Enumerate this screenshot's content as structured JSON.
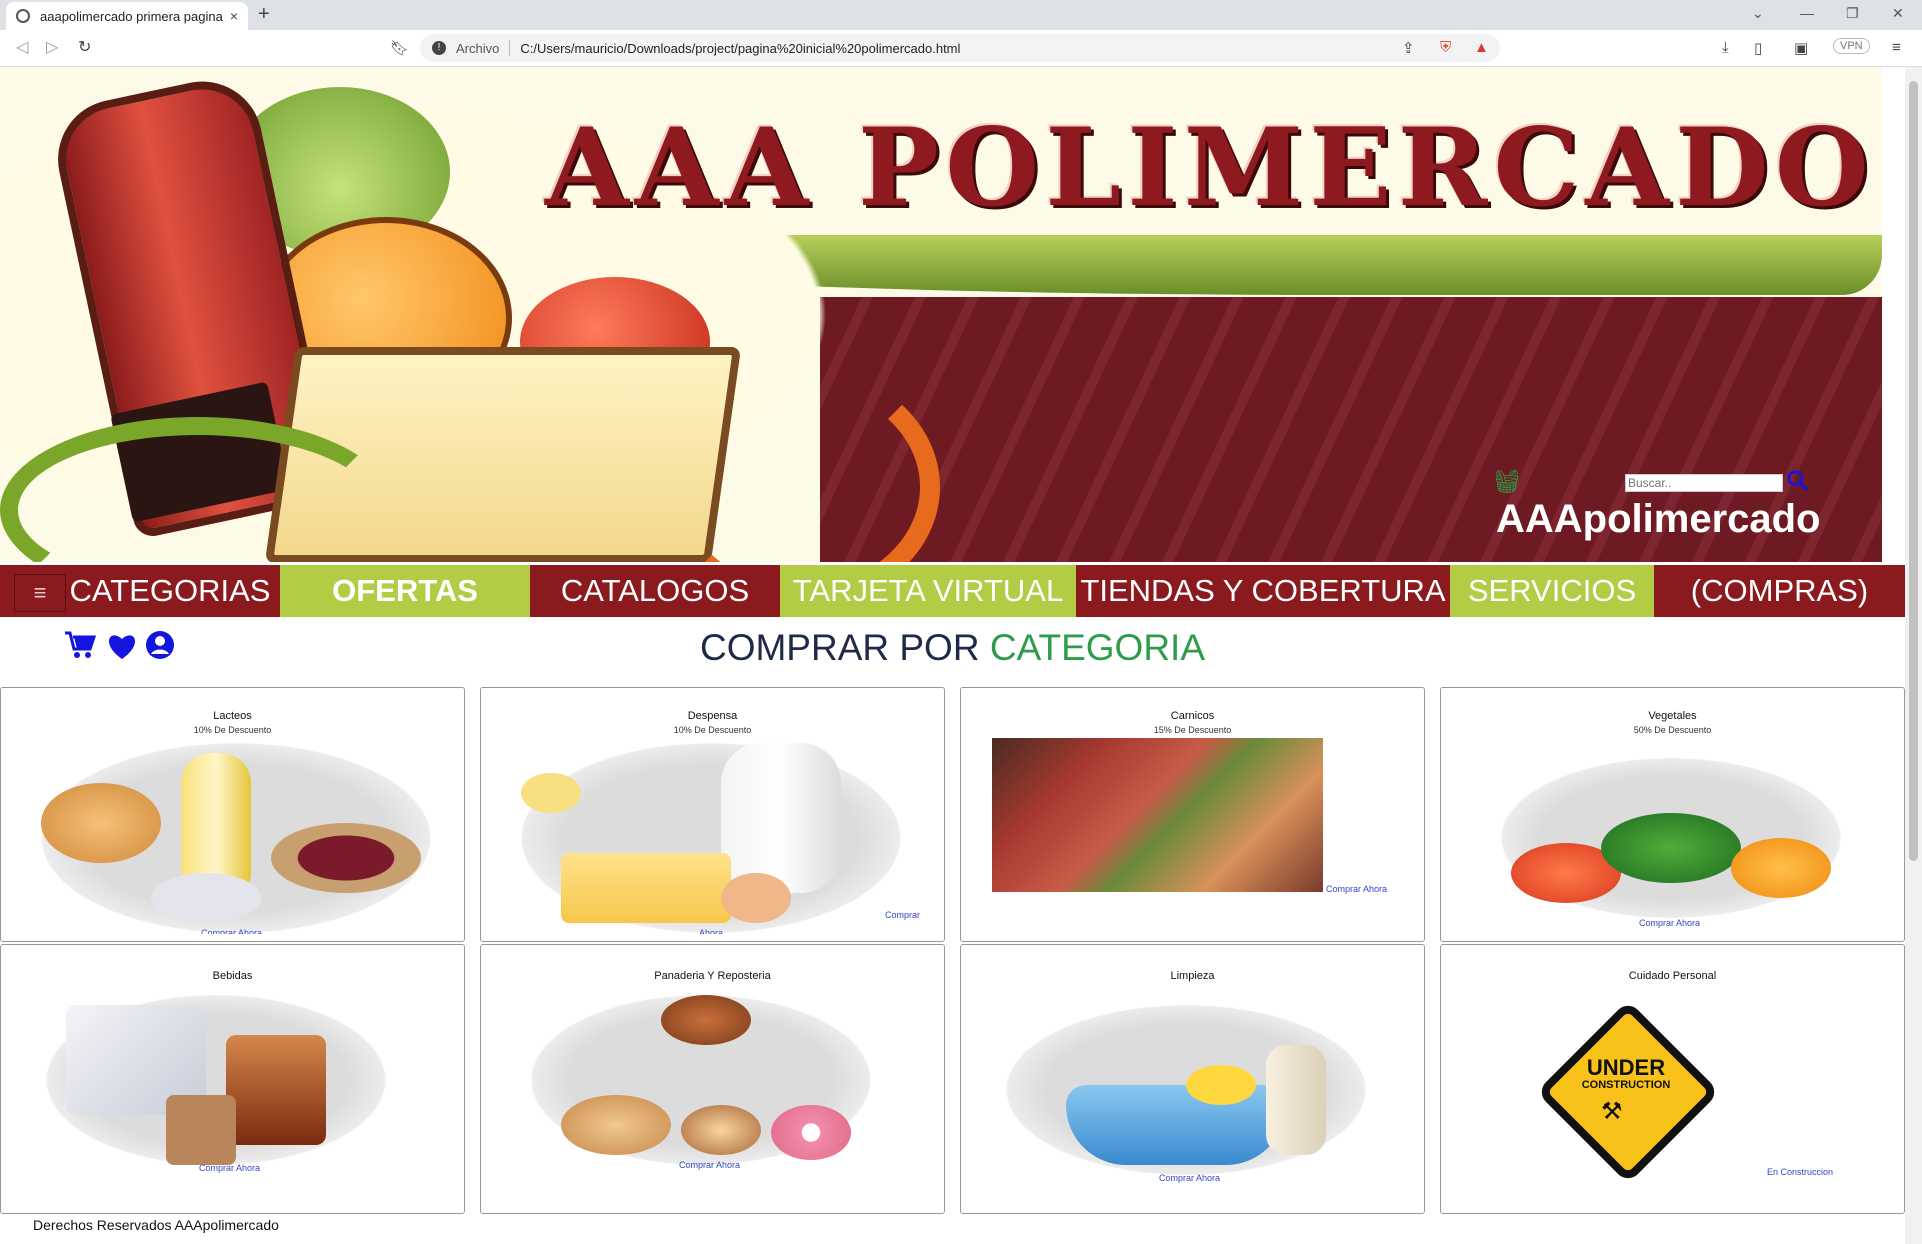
{
  "browser": {
    "tab_title": "aaapolimercado primera pagina",
    "close_glyph": "×",
    "new_tab_glyph": "+",
    "address_scheme": "Archivo",
    "address_url": "C:/Users/mauricio/Downloads/project/pagina%20inicial%20polimercado.html",
    "vpn_label": "VPN"
  },
  "banner": {
    "title": "AAA POLIMERCADO",
    "brand": "AAApolimercado",
    "search_placeholder": "Buscar.."
  },
  "nav": {
    "menu_glyph": "≡",
    "items": [
      {
        "label": "CATEGORIAS",
        "style": "red"
      },
      {
        "label": "OFERTAS",
        "style": "green"
      },
      {
        "label": "CATALOGOS",
        "style": "red"
      },
      {
        "label": "TARJETA VIRTUAL",
        "style": "green"
      },
      {
        "label": "TIENDAS Y COBERTURA",
        "style": "red"
      },
      {
        "label": "SERVICIOS",
        "style": "green"
      },
      {
        "label": "(COMPRAS)",
        "style": "red"
      }
    ]
  },
  "section": {
    "title_part1": "COMPRAR POR",
    "title_part2": "CATEGORIA"
  },
  "cards": [
    {
      "name": "Lacteos",
      "discount": "10% De Descuento",
      "link": "Comprar Ahora"
    },
    {
      "name": "Despensa",
      "discount": "10% De Descuento",
      "link": "Comprar",
      "link2": "Ahora"
    },
    {
      "name": "Carnicos",
      "discount": "15% De Descuento",
      "link": "Comprar Ahora"
    },
    {
      "name": "Vegetales",
      "discount": "50% De Descuento",
      "link": "Comprar Ahora"
    },
    {
      "name": "Bebidas",
      "discount": "",
      "link": "Comprar Ahora"
    },
    {
      "name": "Panaderia Y Reposteria",
      "discount": "",
      "link": "Comprar Ahora"
    },
    {
      "name": "Limpieza",
      "discount": "",
      "link": "Comprar Ahora"
    },
    {
      "name": "Cuidado Personal",
      "discount": "",
      "link": "En Construccion",
      "sign_line1": "UNDER",
      "sign_line2": "CONSTRUCTION"
    }
  ],
  "footer": {
    "text": "Derechos Reservados AAApolimercado"
  },
  "colors": {
    "nav_red": "#8b1a1f",
    "nav_green": "#b3cc45",
    "title_navy": "#1f2a48",
    "title_green": "#2e9c4a",
    "link_blue": "#3845c8",
    "icon_blue": "#1515e0"
  }
}
